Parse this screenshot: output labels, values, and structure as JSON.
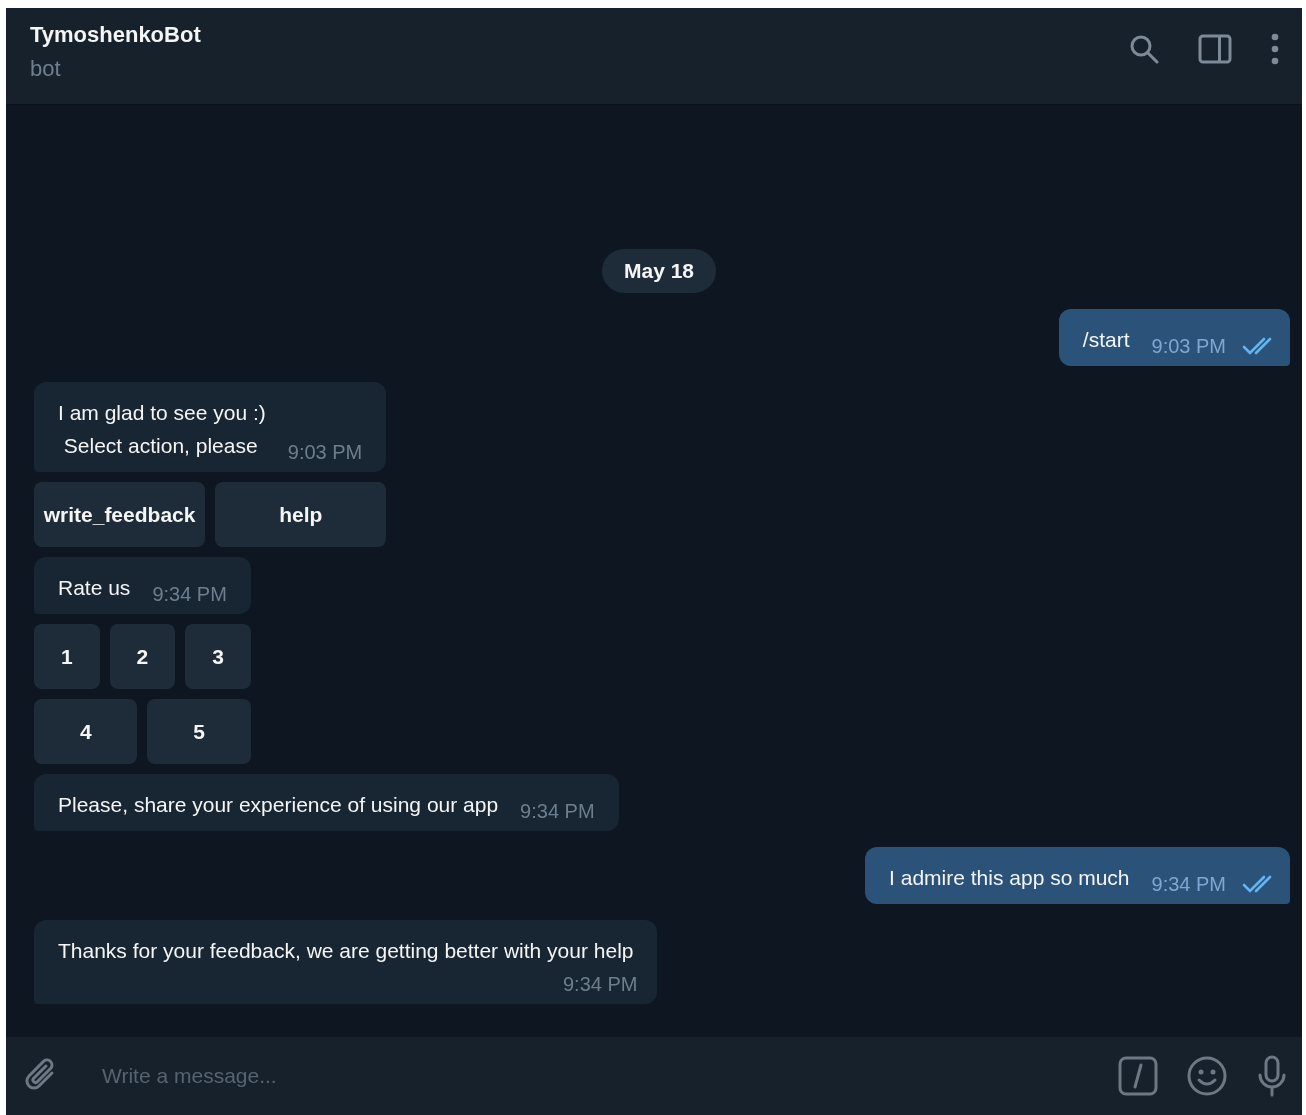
{
  "header": {
    "title": "TymoshenkoBot",
    "subtitle": "bot"
  },
  "messages": [
    {
      "kind": "date",
      "text": "May 18"
    },
    {
      "kind": "out",
      "text": "/start",
      "time": "9:03 PM",
      "read": true
    },
    {
      "kind": "in",
      "text": "I am glad to see you :)\n Select action, please",
      "time": "9:03 PM",
      "time_below": false,
      "keyboard": [
        [
          "write_feedback",
          "help"
        ]
      ]
    },
    {
      "kind": "in",
      "text": "Rate us",
      "time": "9:34 PM",
      "time_below": false,
      "keyboard": [
        [
          "1",
          "2",
          "3"
        ],
        [
          "4",
          "5"
        ]
      ]
    },
    {
      "kind": "in",
      "text": "Please, share your experience of using our app",
      "time": "9:34 PM",
      "time_below": false
    },
    {
      "kind": "out",
      "text": "I admire this app so much",
      "time": "9:34 PM",
      "read": true
    },
    {
      "kind": "in",
      "text": "Thanks for your feedback, we are getting better with your help",
      "time": "9:34 PM",
      "time_below": true
    }
  ],
  "composer": {
    "placeholder": "Write a message..."
  }
}
